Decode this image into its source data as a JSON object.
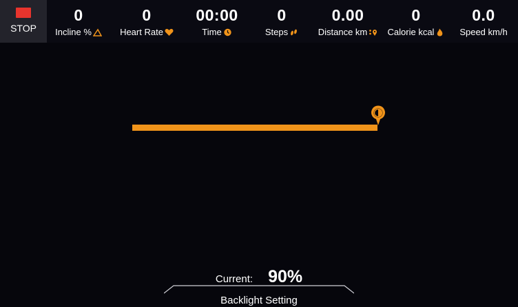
{
  "stop": {
    "label": "STOP",
    "color": "#e8342d"
  },
  "metrics": [
    {
      "value": "0",
      "label": "Incline %",
      "icon": "incline-icon"
    },
    {
      "value": "0",
      "label": "Heart Rate",
      "icon": "heart-icon"
    },
    {
      "value": "00:00",
      "label": "Time",
      "icon": "clock-icon"
    },
    {
      "value": "0",
      "label": "Steps",
      "icon": "footsteps-icon"
    },
    {
      "value": "0.00",
      "label": "Distance km",
      "icon": "location-pin-icon"
    },
    {
      "value": "0",
      "label": "Calorie kcal",
      "icon": "flame-icon"
    },
    {
      "value": "0.0",
      "label": "Speed km/h",
      "icon": ""
    }
  ],
  "backlight": {
    "current_label": "Current:",
    "current_value": "90%",
    "level": 0.9,
    "title": "Backlight Setting",
    "handle_icon": "brightness-icon"
  },
  "colors": {
    "accent": "#f0931a",
    "background": "#06060c",
    "header": "#0a0a12"
  }
}
